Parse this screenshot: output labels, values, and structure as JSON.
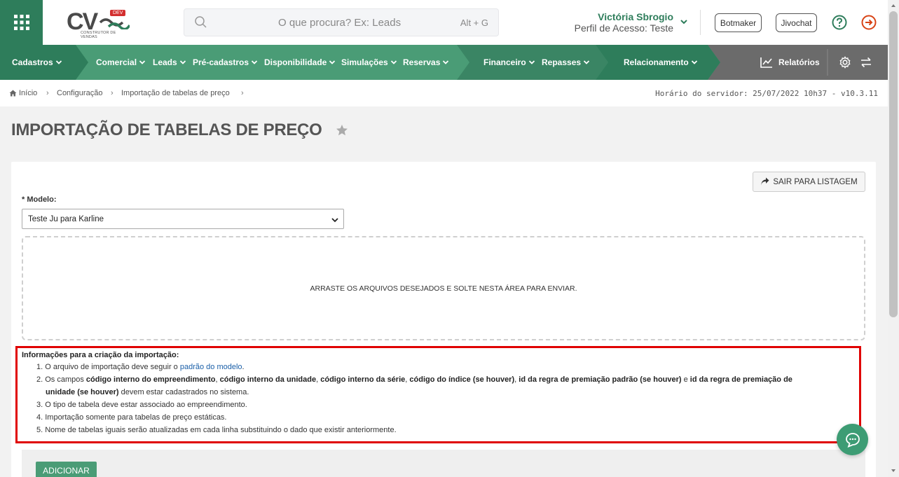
{
  "header": {
    "logo_text": "CV",
    "logo_badge": "DEV",
    "logo_subtitle": "CONSTRUTOR DE VENDAS",
    "search_placeholder": "O que procura? Ex: Leads",
    "search_shortcut": "Alt + G",
    "user_name": "Victória Sbrogio",
    "user_profile": "Perfil de Acesso: Teste",
    "botmaker_label": "Botmaker",
    "jivochat_label": "Jivochat"
  },
  "nav": {
    "items": [
      {
        "label": "Cadastros"
      },
      {
        "label": "Comercial"
      },
      {
        "label": "Leads"
      },
      {
        "label": "Pré-cadastros"
      },
      {
        "label": "Disponibilidade"
      },
      {
        "label": "Simulações"
      },
      {
        "label": "Reservas"
      },
      {
        "label": "Financeiro"
      },
      {
        "label": "Repasses"
      },
      {
        "label": "Relacionamento"
      }
    ],
    "reports_label": "Relatórios"
  },
  "breadcrumb": {
    "items": [
      "Início",
      "Configuração",
      "Importação de tabelas de preço"
    ],
    "server_time": "Horário do servidor: 25/07/2022 10h37 - v10.3.11"
  },
  "page": {
    "title": "IMPORTAÇÃO DE TABELAS DE PREÇO",
    "back_button": "SAIR PARA LISTAGEM",
    "model_label": "* Modelo:",
    "model_value": "Teste Ju para Karline",
    "dropzone_text": "ARRASTE OS ARQUIVOS DESEJADOS E SOLTE NESTA ÁREA PARA ENVIAR.",
    "add_button": "ADICIONAR"
  },
  "info": {
    "title": "Informações para a criação da importação:",
    "line1_prefix": "1.  O arquivo de importação deve seguir o ",
    "line1_link": "padrão do modelo",
    "line1_suffix": ".",
    "line2_a": "2.  Os campos ",
    "line2_b1": "código interno do empreendimento",
    "line2_c1": ", ",
    "line2_b2": "código interno da unidade",
    "line2_c2": ", ",
    "line2_b3": "código interno da série",
    "line2_c3": ", ",
    "line2_b4": "código do índice (se houver)",
    "line2_c4": ", ",
    "line2_b5": "id da regra de premiação padrão (se houver)",
    "line2_c5": " e ",
    "line2_b6": "id da regra de premiação de",
    "line2_b7": "unidade (se houver)",
    "line2_end": " devem estar cadastrados no sistema.",
    "line3": "3.  O tipo de tabela deve estar associado ao empreendimento.",
    "line4": "4.  Importação somente para tabelas de preço estáticas.",
    "line5": "5.  Nome de tabelas iguais serão atualizadas em cada linha substituindo o dado que existir anteriormente."
  },
  "colors": {
    "brand_green": "#2e7d5b",
    "nav_green": "#4a9c76",
    "nav_dark": "#3a8564",
    "nav_gray": "#6b6b6b",
    "highlight_red": "#e00000"
  }
}
